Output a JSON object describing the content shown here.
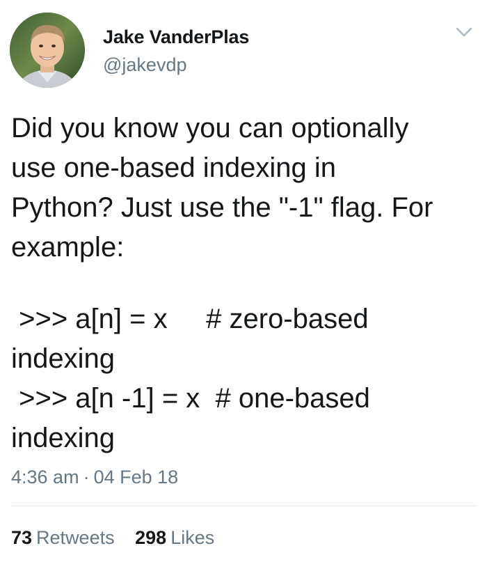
{
  "author": {
    "display_name": "Jake VanderPlas",
    "handle": "@jakevdp"
  },
  "icons": {
    "avatar": "profile-photo",
    "caret": "chevron-down-icon"
  },
  "tweet": {
    "text_lines": [
      "Did you know you can optionally",
      "use one-based indexing in",
      "Python? Just use the \"-1\" flag. For",
      "example:"
    ],
    "code": [
      {
        "line": " >>> a[n] = x     # zero-based",
        "wrap": "indexing"
      },
      {
        "line": " >>> a[n -1] = x  # one-based",
        "wrap": "indexing"
      }
    ]
  },
  "meta": {
    "time": "4:36 am",
    "separator": "·",
    "date": "04 Feb 18"
  },
  "stats": {
    "retweets_count": "73",
    "retweets_label": "Retweets",
    "likes_count": "298",
    "likes_label": "Likes"
  },
  "colors": {
    "text": "#14171a",
    "secondary": "#657786",
    "divider": "#e1e8ed"
  }
}
